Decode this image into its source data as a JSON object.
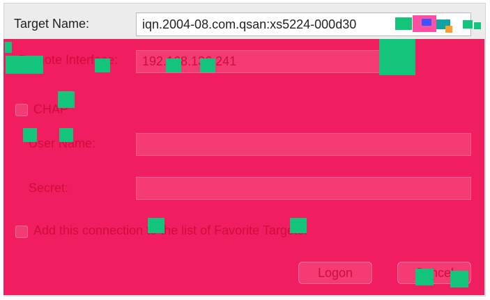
{
  "dialog": {
    "target_name_label": "Target Name:",
    "target_name_value": "iqn.2004-08.com.qsan:xs5224-000d30",
    "remote_interface_label": "Remote Interface:",
    "remote_interface_value": "192.168.136.241",
    "chap_label": "CHAP",
    "user_name_label": "User Name:",
    "user_name_value": "",
    "secret_label": "Secret:",
    "secret_value": "",
    "favorite_label": "Add this connection to the list of Favorite Targets.",
    "logon_button": "Logon",
    "cancel_button": "Cancel"
  },
  "colors": {
    "overlay": "#f01e60",
    "overlay_text": "#d10b3a",
    "glitch_green": "#12c57a"
  }
}
